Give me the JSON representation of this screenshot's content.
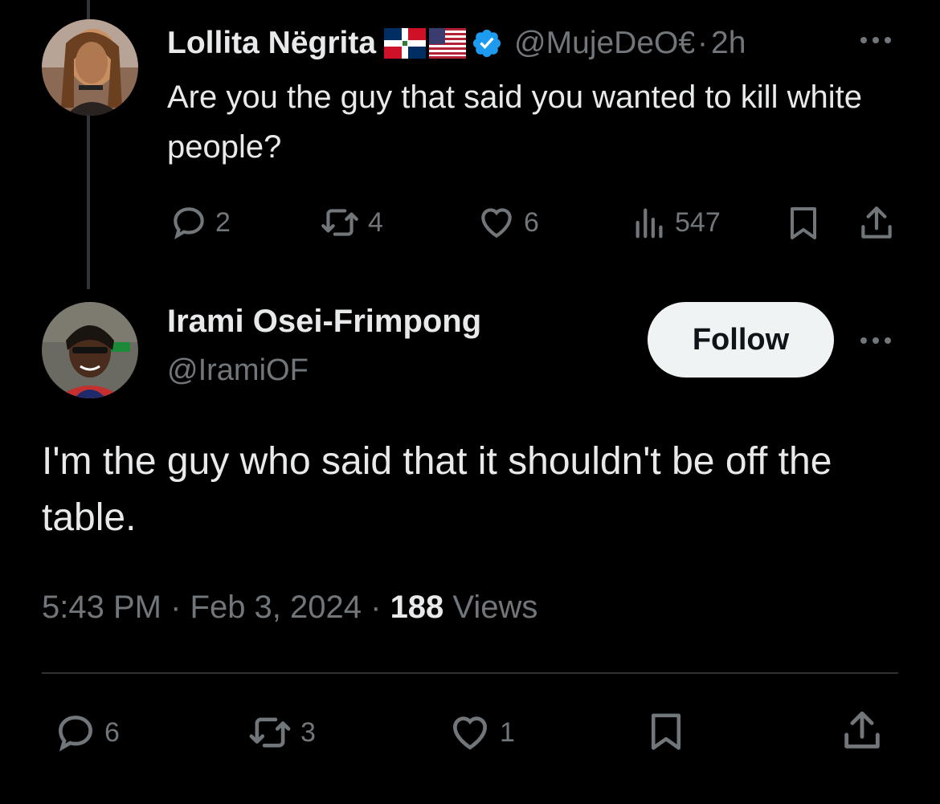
{
  "parent_tweet": {
    "name": "Lollita Nëgrita",
    "handle": "@MujeDeO€",
    "separator": "·",
    "time": "2h",
    "text": "Are you the guy that said you wanted to kill white people?",
    "flags": [
      "dominican-republic-flag",
      "united-states-flag"
    ],
    "verified_color": "#1d9bf0",
    "actions": {
      "replies": "2",
      "reposts": "4",
      "likes": "6",
      "views": "547"
    }
  },
  "main_tweet": {
    "name": "Irami Osei-Frimpong",
    "handle": "@IramiOF",
    "follow_label": "Follow",
    "text": "I'm the guy who said that it shouldn't be off the table.",
    "timestamp": "5:43 PM · Feb 3, 2024 · ",
    "views_count": "188",
    "views_label": " Views",
    "actions": {
      "replies": "6",
      "reposts": "3",
      "likes": "1"
    }
  },
  "colors": {
    "background": "#000000",
    "text_primary": "#e7e9ea",
    "text_secondary": "#71767b",
    "follow_bg": "#eff3f4",
    "divider": "#2f3336"
  }
}
